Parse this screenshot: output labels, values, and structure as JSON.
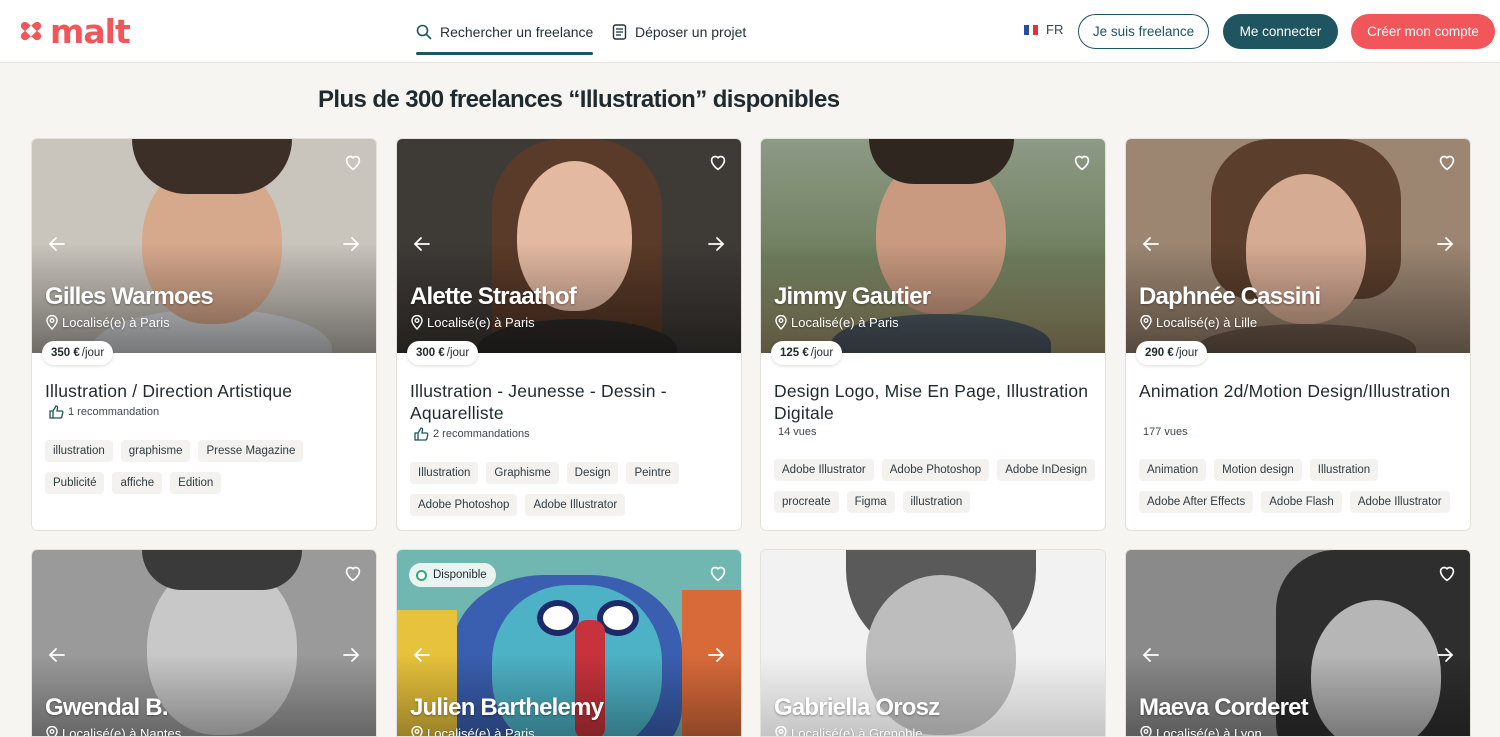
{
  "header": {
    "logo_text": "malt",
    "nav": {
      "search_label": "Rechercher un freelance",
      "project_label": "Déposer un projet"
    },
    "lang": "FR",
    "btn_freelance": "Je suis freelance",
    "btn_login": "Me connecter",
    "btn_signup": "Créer mon compte"
  },
  "page_title": "Plus de 300 freelances “Illustration” disponibles",
  "colors": {
    "brand": "#f0565a",
    "teal": "#1f5560",
    "available": "#3aa57a"
  },
  "cards": [
    {
      "name": "Gilles Warmoes",
      "location": "Localisé(e) à Paris",
      "price": "350 €",
      "price_unit": "/jour",
      "title": "Illustration / Direction Artistique",
      "meta": "1 recommandation",
      "meta_icon": "thumbs-up-icon",
      "tags": [
        "illustration",
        "graphisme",
        "Presse Magazine",
        "Publicité",
        "affiche",
        "Edition"
      ]
    },
    {
      "name": "Alette Straathof",
      "location": "Localisé(e) à Paris",
      "price": "300 €",
      "price_unit": "/jour",
      "title": "Illustration - Jeunesse - Dessin - Aquarelliste",
      "meta": "2 recommandations",
      "meta_icon": "thumbs-up-icon",
      "tags": [
        "Illustration",
        "Graphisme",
        "Design",
        "Peintre",
        "Adobe Photoshop",
        "Adobe Illustrator"
      ]
    },
    {
      "name": "Jimmy Gautier",
      "location": "Localisé(e) à Paris",
      "price": "125 €",
      "price_unit": "/jour",
      "title": "Design Logo, Mise En Page, Illustration Digitale",
      "meta": "14  vues",
      "meta_icon": "",
      "tags": [
        "Adobe Illustrator",
        "Adobe Photoshop",
        "Adobe InDesign",
        "procreate",
        "Figma",
        "illustration"
      ]
    },
    {
      "name": "Daphnée Cassini",
      "location": "Localisé(e) à Lille",
      "price": "290 €",
      "price_unit": "/jour",
      "title": "Animation 2d/Motion Design/Illustration",
      "meta": "177  vues",
      "meta_icon": "",
      "tags": [
        "Animation",
        "Motion design",
        "Illustration",
        "Adobe After Effects",
        "Adobe Flash",
        "Adobe Illustrator"
      ]
    },
    {
      "name": "Gwendal B.",
      "location": "Localisé(e) à Nantes",
      "badge": ""
    },
    {
      "name": "Julien Barthelemy",
      "location": "Localisé(e) à Paris",
      "badge": "Disponible"
    },
    {
      "name": "Gabriella Orosz",
      "location": "Localisé(e) à Grenoble",
      "badge": ""
    },
    {
      "name": "Maeva Corderet",
      "location": "Localisé(e) à Lyon",
      "badge": ""
    }
  ]
}
